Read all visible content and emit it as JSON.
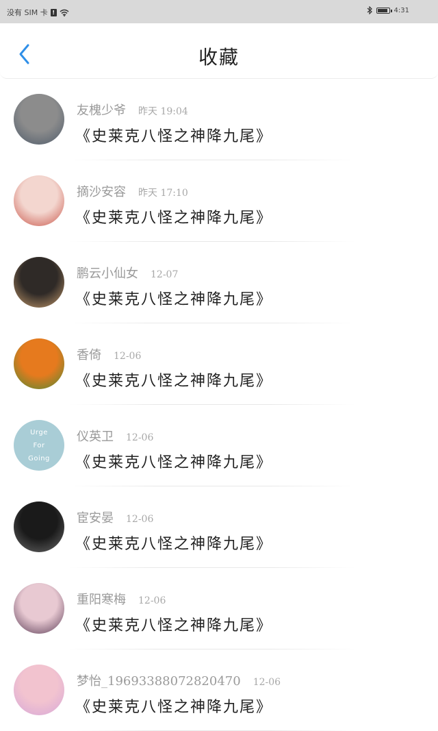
{
  "status_bar": {
    "carrier": "没有 SIM 卡",
    "time": "4:31"
  },
  "header": {
    "title": "收藏"
  },
  "favorites": [
    {
      "user": "友槐少爷",
      "time": "昨天 19:04",
      "title": "《史莱克八怪之神降九尾》",
      "avatar_colors": [
        "#8c8c8c",
        "#4d5a6a"
      ]
    },
    {
      "user": "摘沙安容",
      "time": "昨天 17:10",
      "title": "《史莱克八怪之神降九尾》",
      "avatar_colors": [
        "#f3d6cf",
        "#c9564a"
      ]
    },
    {
      "user": "鹏云小仙女",
      "time": "12-07",
      "title": "《史莱克八怪之神降九尾》",
      "avatar_colors": [
        "#2f2a27",
        "#c49a6c"
      ]
    },
    {
      "user": "香倚",
      "time": "12-06",
      "title": "《史莱克八怪之神降九尾》",
      "avatar_colors": [
        "#e67a1e",
        "#4f8a34"
      ]
    },
    {
      "user": "仪英卫",
      "time": "12-06",
      "title": "《史莱克八怪之神降九尾》",
      "avatar_colors": [
        "#a9cdd6",
        "#a9cdd6"
      ],
      "avatar_text": "Urge For Going"
    },
    {
      "user": "宦安晏",
      "time": "12-06",
      "title": "《史莱克八怪之神降九尾》",
      "avatar_colors": [
        "#1a1a1a",
        "#6a6a6a"
      ]
    },
    {
      "user": "重阳寒梅",
      "time": "12-06",
      "title": "《史莱克八怪之神降九尾》",
      "avatar_colors": [
        "#e8c9d2",
        "#5a3b55"
      ]
    },
    {
      "user": "梦怡_19693388072820470",
      "time": "12-06",
      "title": "《史莱克八怪之神降九尾》",
      "avatar_colors": [
        "#f2c3cf",
        "#d6a7d8"
      ]
    }
  ]
}
